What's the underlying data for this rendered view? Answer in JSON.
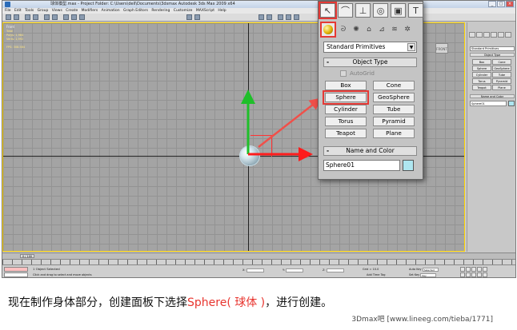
{
  "window": {
    "title": "球体模型.max - Project Folder: C:\\Users\\dell\\Documents\\3dsmax                    Autodesk 3ds Max 2009 x64",
    "controls": [
      "_",
      "□",
      "×"
    ]
  },
  "menu": [
    "File",
    "Edit",
    "Tools",
    "Group",
    "Views",
    "Create",
    "Modifiers",
    "Animation",
    "Graph Editors",
    "Rendering",
    "Customize",
    "MAXScript",
    "Help"
  ],
  "viewport": {
    "label": "Front",
    "stats": "Total\nPolys: 1,984\nVerts: 1,992\n\nFPS: 308.584",
    "viewcube_label": "FRONT"
  },
  "mini_panel": {
    "dropdown": "Standard Primitives",
    "object_type_header": "Object Type",
    "buttons": [
      "Box",
      "Cone",
      "Sphere",
      "GeoSphere",
      "Cylinder",
      "Tube",
      "Torus",
      "Pyramid",
      "Teapot",
      "Plane"
    ],
    "name_color_header": "Name and Color",
    "name_value": "Sphere01"
  },
  "timeslider": {
    "label": "0 / 100"
  },
  "status": {
    "selected": "1 Object Selected",
    "hint": "Click and drag to select and move objects",
    "x_label": "X:",
    "y_label": "Y:",
    "z_label": "Z:",
    "grid": "Grid = 10.0",
    "time_tag": "Add Time Tag",
    "auto_key": "Auto Key",
    "set_key": "Set Key",
    "selected_dd": "Selected",
    "key_filters": "Key Filters..."
  },
  "command_panel": {
    "tabs": [
      {
        "icon": "create-icon",
        "glyph": "↖"
      },
      {
        "icon": "modify-icon",
        "glyph": "⌒"
      },
      {
        "icon": "hierarchy-icon",
        "glyph": "⊥"
      },
      {
        "icon": "motion-icon",
        "glyph": "◎"
      },
      {
        "icon": "display-icon",
        "glyph": "▣"
      },
      {
        "icon": "utilities-icon",
        "glyph": "T"
      }
    ],
    "subtabs": [
      {
        "icon": "geometry-icon"
      },
      {
        "icon": "shapes-icon",
        "glyph": "ᘐ"
      },
      {
        "icon": "lights-icon",
        "glyph": "✺"
      },
      {
        "icon": "cameras-icon",
        "glyph": "⌂"
      },
      {
        "icon": "helpers-icon",
        "glyph": "⊿"
      },
      {
        "icon": "spacewarps-icon",
        "glyph": "≋"
      },
      {
        "icon": "systems-icon",
        "glyph": "✲"
      }
    ],
    "dropdown": "Standard Primitives",
    "object_type": {
      "header": "Object Type",
      "autogrid": "AutoGrid",
      "buttons": [
        "Box",
        "Cone",
        "Sphere",
        "GeoSphere",
        "Cylinder",
        "Tube",
        "Torus",
        "Pyramid",
        "Teapot",
        "Plane"
      ],
      "highlighted": "Sphere"
    },
    "name_and_color": {
      "header": "Name and Color",
      "name": "Sphere01",
      "color": "#aee6f0"
    }
  },
  "caption": {
    "before": "现在制作身体部分，创建面板下选择",
    "highlight": "Sphere( 球体 )",
    "after": "，进行创建。"
  },
  "watermark": "3Dmax吧 [www.lineeg.com/tieba/1771]",
  "colors": {
    "highlight_red": "#e53935",
    "viewport_bg": "#a4a4a4",
    "sphere_color": "#aee6f0"
  }
}
